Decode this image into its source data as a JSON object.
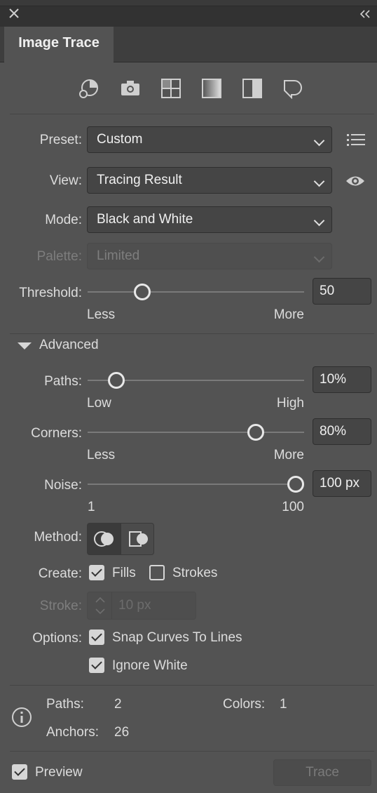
{
  "window": {
    "close_icon": "close-icon",
    "collapse_icon": "double-chevron-left-icon",
    "tab_title": "Image Trace"
  },
  "toolbar_icons": [
    "auto-color-icon",
    "camera-high-color-icon",
    "low-color-icon",
    "grayscale-icon",
    "black-white-icon",
    "outline-icon"
  ],
  "preset": {
    "label": "Preset:",
    "value": "Custom",
    "menu_icon": "list-icon"
  },
  "view": {
    "label": "View:",
    "value": "Tracing Result",
    "eye_icon": "eye-icon"
  },
  "mode": {
    "label": "Mode:",
    "value": "Black and White"
  },
  "palette": {
    "label": "Palette:",
    "value": "Limited",
    "disabled": true
  },
  "threshold": {
    "label": "Threshold:",
    "value": "50",
    "min_label": "Less",
    "max_label": "More",
    "fraction": 0.23
  },
  "advanced": {
    "label": "Advanced",
    "expanded": true
  },
  "paths": {
    "label": "Paths:",
    "value": "10%",
    "min_label": "Low",
    "max_label": "High",
    "fraction": 0.1
  },
  "corners": {
    "label": "Corners:",
    "value": "80%",
    "min_label": "Less",
    "max_label": "More",
    "fraction": 0.8
  },
  "noise": {
    "label": "Noise:",
    "value": "100 px",
    "min_label": "1",
    "max_label": "100",
    "fraction": 1.0
  },
  "method": {
    "label": "Method:",
    "options": [
      "abutting",
      "overlapping"
    ],
    "selected": "abutting"
  },
  "create": {
    "label": "Create:",
    "fills_label": "Fills",
    "fills_checked": true,
    "strokes_label": "Strokes",
    "strokes_checked": false
  },
  "stroke": {
    "label": "Stroke:",
    "value": "10 px",
    "disabled": true
  },
  "options": {
    "label": "Options:",
    "snap_label": "Snap Curves To Lines",
    "snap_checked": true,
    "ignore_label": "Ignore White",
    "ignore_checked": true
  },
  "info": {
    "paths_label": "Paths:",
    "paths_value": "2",
    "colors_label": "Colors:",
    "colors_value": "1",
    "anchors_label": "Anchors:",
    "anchors_value": "26"
  },
  "footer": {
    "preview_label": "Preview",
    "preview_checked": true,
    "trace_label": "Trace"
  },
  "colors": {
    "panel_bg": "#535353",
    "text": "#e6e6e6",
    "disabled_text": "#7d7d7d"
  }
}
